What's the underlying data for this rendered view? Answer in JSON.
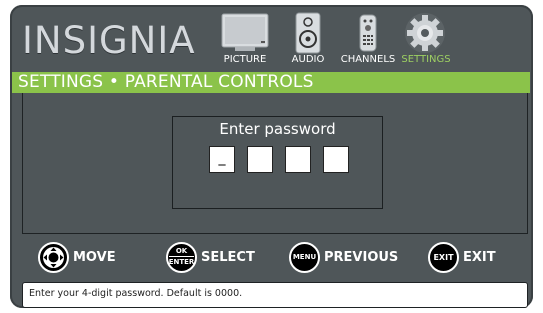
{
  "brand": {
    "logo_text": "INSIGNIA"
  },
  "top_menu": {
    "items": [
      {
        "label": "PICTURE",
        "icon": "tv-icon",
        "active": false
      },
      {
        "label": "AUDIO",
        "icon": "speaker-icon",
        "active": false
      },
      {
        "label": "CHANNELS",
        "icon": "remote-icon",
        "active": false
      },
      {
        "label": "SETTINGS",
        "icon": "gear-icon",
        "active": true
      }
    ],
    "active_color": "#9dcf62"
  },
  "section": {
    "title": "SETTINGS • PARENTAL CONTROLS",
    "color": "#8bc34a"
  },
  "password_dialog": {
    "label": "Enter password",
    "digits": [
      "_",
      "",
      "",
      ""
    ]
  },
  "hints": [
    {
      "key": "",
      "key_icon": "directional-pad-icon",
      "label": "MOVE"
    },
    {
      "key": "OK\nENTER",
      "key_icon": "ok-enter-icon",
      "label": "SELECT"
    },
    {
      "key": "MENU",
      "key_icon": "menu-button-icon",
      "label": "PREVIOUS"
    },
    {
      "key": "EXIT",
      "key_icon": "exit-button-icon",
      "label": "EXIT"
    }
  ],
  "status": {
    "message": "Enter your 4-digit password. Default is 0000."
  }
}
